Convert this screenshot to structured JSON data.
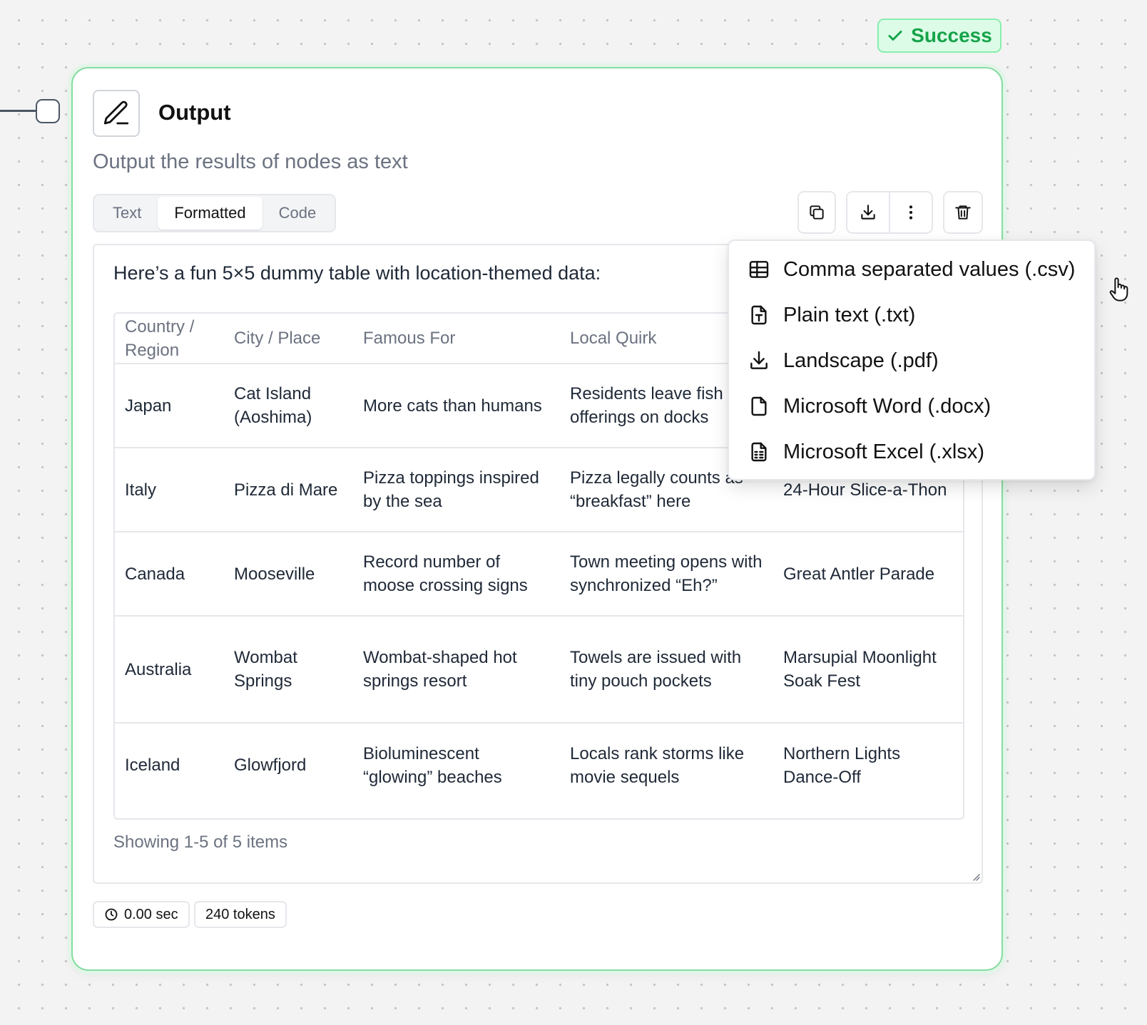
{
  "status": {
    "label": "Success"
  },
  "node": {
    "title": "Output",
    "subtitle": "Output the results of nodes as text",
    "tabs": [
      {
        "label": "Text",
        "active": false
      },
      {
        "label": "Formatted",
        "active": true
      },
      {
        "label": "Code",
        "active": false
      }
    ],
    "intro": "Here’s a fun 5×5 dummy table with location-themed data:",
    "table": {
      "headers": [
        "Country / Region",
        "City / Place",
        "Famous For",
        "Local Quirk",
        ""
      ],
      "rows": [
        [
          "Japan",
          "Cat Island (Aoshima)",
          "More cats than humans",
          "Residents leave fish offerings on docks",
          ""
        ],
        [
          "Italy",
          "Pizza di Mare",
          "Pizza toppings inspired by the sea",
          "Pizza legally counts as “breakfast” here",
          "24-Hour Slice-a-Thon"
        ],
        [
          "Canada",
          "Mooseville",
          "Record number of moose crossing signs",
          "Town meeting opens with synchronized “Eh?”",
          "Great Antler Parade"
        ],
        [
          "Australia",
          "Wombat Springs",
          "Wombat-shaped hot springs resort",
          "Towels are issued with tiny pouch pockets",
          "Marsupial Moonlight Soak Fest"
        ],
        [
          "Iceland",
          "Glowfjord",
          "Bioluminescent “glowing” beaches",
          "Locals rank storms like movie sequels",
          "Northern Lights Dance-Off"
        ]
      ]
    },
    "pagination": "Showing 1-5 of 5 items",
    "stats": {
      "time": "0.00 sec",
      "tokens": "240 tokens"
    }
  },
  "download_menu": {
    "items": [
      {
        "label": "Comma separated values (.csv)",
        "icon": "table-icon"
      },
      {
        "label": "Plain text (.txt)",
        "icon": "text-file-icon"
      },
      {
        "label": "Landscape (.pdf)",
        "icon": "download-icon"
      },
      {
        "label": "Microsoft Word (.docx)",
        "icon": "file-icon"
      },
      {
        "label": "Microsoft Excel (.xlsx)",
        "icon": "spreadsheet-file-icon"
      }
    ]
  },
  "colors": {
    "success": "#16a34a",
    "success_bg": "#dcfce7",
    "node_border": "#86dca0"
  }
}
